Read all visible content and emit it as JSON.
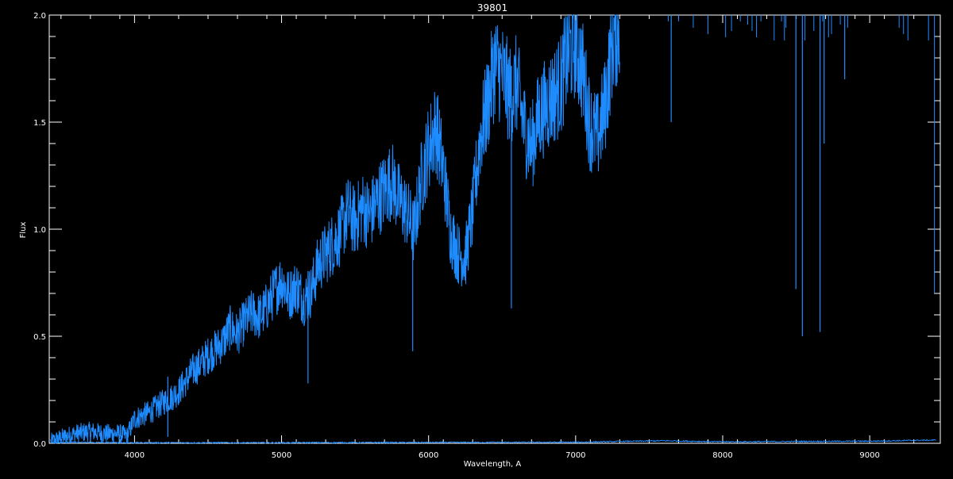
{
  "chart_data": {
    "type": "line",
    "title": "39801",
    "xlabel": "Wavelength, A",
    "ylabel": "Flux",
    "xlim": [
      3420,
      9480
    ],
    "ylim": [
      0.0,
      2.0
    ],
    "x_ticks": [
      4000,
      5000,
      6000,
      7000,
      8000,
      9000
    ],
    "x_tick_labels": [
      "4000",
      "5000",
      "6000",
      "7000",
      "8000",
      "9000"
    ],
    "y_ticks": [
      0.0,
      0.5,
      1.0,
      1.5,
      2.0
    ],
    "y_tick_labels": [
      "0.0",
      "0.5",
      "1.0",
      "1.5",
      "2.0"
    ],
    "grid": false,
    "colors": {
      "background": "#000000",
      "axes": "#ffffff",
      "spectrum": "#1e8cff",
      "error": "#1e8cff"
    },
    "series": [
      {
        "x": [
          3430,
          3500,
          3600,
          3700,
          3800,
          3900,
          3950,
          4000,
          4100,
          4200,
          4250,
          4300,
          4350,
          4400,
          4450,
          4500,
          4550,
          4600,
          4650,
          4700,
          4750,
          4800,
          4850,
          4900,
          4950,
          5000,
          5050,
          5100,
          5150,
          5200,
          5250,
          5300,
          5350,
          5400,
          5450,
          5500,
          5550,
          5600,
          5650,
          5700,
          5750,
          5800,
          5850,
          5900,
          5950,
          6000,
          6050,
          6100,
          6150,
          6200,
          6250,
          6300,
          6350,
          6400,
          6450,
          6500,
          6550,
          6600,
          6650,
          6700,
          6750,
          6800,
          6850,
          6900,
          6950,
          7000,
          7050,
          7100,
          7150,
          7200,
          7250,
          7300
        ],
        "values": [
          0.01,
          0.03,
          0.05,
          0.06,
          0.05,
          0.05,
          0.04,
          0.12,
          0.15,
          0.2,
          0.22,
          0.25,
          0.3,
          0.35,
          0.38,
          0.42,
          0.45,
          0.48,
          0.55,
          0.52,
          0.58,
          0.62,
          0.6,
          0.65,
          0.72,
          0.78,
          0.7,
          0.75,
          0.68,
          0.72,
          0.85,
          0.9,
          0.95,
          1.0,
          1.1,
          1.05,
          1.12,
          1.08,
          1.15,
          1.2,
          1.25,
          1.15,
          1.1,
          1.0,
          1.25,
          1.4,
          1.5,
          1.3,
          1.0,
          0.9,
          0.88,
          1.1,
          1.45,
          1.6,
          1.8,
          1.75,
          1.65,
          1.7,
          1.5,
          1.4,
          1.55,
          1.6,
          1.65,
          1.7,
          1.85,
          1.9,
          1.75,
          1.5,
          1.45,
          1.6,
          1.9,
          2.0
        ]
      },
      {
        "x": [
          3430,
          4000,
          5000,
          6000,
          7000,
          7600,
          8000,
          9000,
          9450
        ],
        "values": [
          0.005,
          0.003,
          0.003,
          0.004,
          0.005,
          0.012,
          0.007,
          0.01,
          0.015
        ]
      }
    ],
    "absorption_lines": [
      {
        "x": 4227,
        "depth_to": 0.03
      },
      {
        "x": 5180,
        "depth_to": 0.28
      },
      {
        "x": 5892,
        "depth_to": 0.43
      },
      {
        "x": 6563,
        "depth_to": 0.63
      },
      {
        "x": 7650,
        "depth_to": 1.5
      },
      {
        "x": 8498,
        "depth_to": 0.72
      },
      {
        "x": 8542,
        "depth_to": 0.5
      },
      {
        "x": 8662,
        "depth_to": 0.52
      },
      {
        "x": 8690,
        "depth_to": 1.4
      },
      {
        "x": 8830,
        "depth_to": 1.7
      }
    ],
    "high_flux_spikes": [
      7630,
      7700,
      7800,
      7900,
      8020,
      8060,
      8120,
      8170,
      8200,
      8230,
      8260,
      8350,
      8400,
      8420,
      8430,
      8560,
      8620,
      8680,
      8720,
      8740,
      8800,
      8850,
      9200,
      9230,
      9260,
      9400
    ]
  }
}
